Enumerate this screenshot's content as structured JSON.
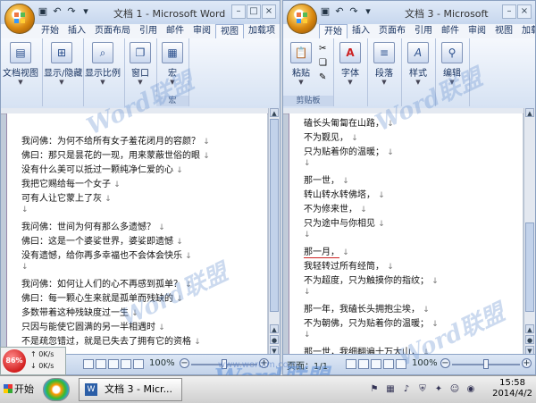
{
  "left_window": {
    "title": "文档 1 - Microsoft Word",
    "tabs": [
      "开始",
      "插入",
      "页面布局",
      "引用",
      "邮件",
      "审阅",
      "视图",
      "加载项"
    ],
    "active_tab": "视图",
    "ribbon": {
      "doc_views": "文档视图",
      "show_hide": "显示/隐藏",
      "zoom": "显示比例",
      "window": "窗口",
      "macro": "宏",
      "macro_group": "宏"
    },
    "lines": [
      "我问佛：为何不给所有女子羞花闭月的容颜？",
      "佛曰：那只是昙花的一现，用来蒙蔽世俗的眼",
      "没有什么美可以抵过一颗纯净仁爱的心",
      "我把它赐给每一个女子",
      "可有人让它蒙上了灰",
      "",
      "我问佛：世间为何有那么多遗憾？",
      "佛曰：这是一个婆娑世界，婆娑即遗憾",
      "没有遗憾，给你再多幸福也不会体会快乐",
      "",
      "我问佛：如何让人们的心不再感到孤单？",
      "佛曰：每一颗心生来就是孤单而残缺的",
      "多数带着这种残缺度过一生",
      "只因与能使它圆满的另一半相遇时",
      "不是疏忽错过，就是已失去了拥有它的资格"
    ],
    "zoom": "100%"
  },
  "right_window": {
    "title": "文档 3 - Microsoft",
    "tabs": [
      "开始",
      "插入",
      "页面布",
      "引用",
      "邮件",
      "审阅",
      "视图",
      "加载项"
    ],
    "active_tab": "开始",
    "ribbon": {
      "paste": "粘贴",
      "font": "字体",
      "paragraph": "段落",
      "styles": "样式",
      "editing": "编辑",
      "clipboard_group": "剪贴板"
    },
    "lines": [
      "磕长头匍匐在山路，",
      "不为觐见，",
      "只为贴着你的温暖；",
      "",
      "那一世，",
      "转山转水转佛塔，",
      "不为修来世，",
      "只为途中与你相见",
      "",
      "那一月，",
      "我轻转过所有经筒，",
      "不为超度，只为触摸你的指纹；",
      "",
      "那一年，我磕长头拥抱尘埃，",
      "不为朝佛，只为贴着你的温暖；",
      "",
      "那一世，我细翻遍十万大山，"
    ],
    "status_page": "页面：1/1",
    "zoom": "100%"
  },
  "network": {
    "percent": "86%",
    "up": "0K/s",
    "down": "0K/s"
  },
  "watermark": {
    "brand": "Word联盟",
    "url": "www.wordlm.com"
  },
  "taskbar": {
    "start": "开始",
    "task": "文档 3 - Micr...",
    "time": "15:58",
    "date": "2014/4/2"
  },
  "colors": {
    "ribbon": "#d6e2f3",
    "watermark": "#6e96d2",
    "net_circle": "#d21f1f"
  }
}
